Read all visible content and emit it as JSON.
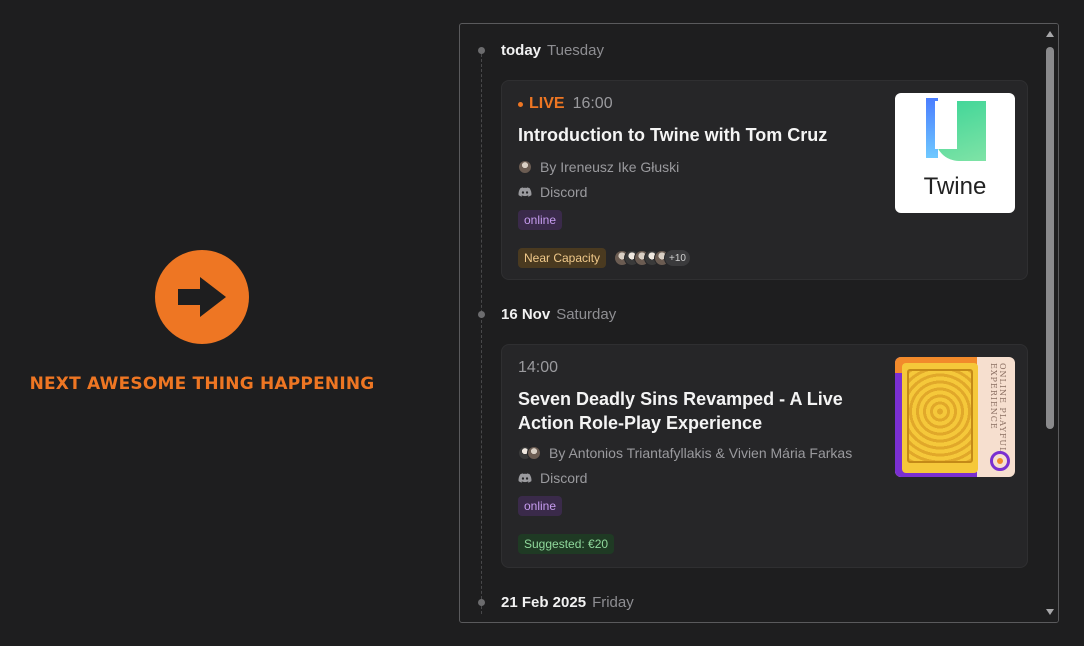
{
  "promo": {
    "title": "NEXT AWESOME THING HAPPENING",
    "icon": "arrow-right-icon",
    "accent": "#ee7623"
  },
  "timeline": {
    "dates": [
      {
        "main": "today",
        "day": "Tuesday"
      },
      {
        "main": "16 Nov",
        "day": "Saturday"
      },
      {
        "main": "21 Feb 2025",
        "day": "Friday"
      }
    ],
    "events": [
      {
        "live_label": "LIVE",
        "time": "16:00",
        "title": "Introduction to Twine with Tom Cruz",
        "by": "By Ireneusz Ike Głuski",
        "platform": "Discord",
        "tag": "online",
        "status": "Near Capacity",
        "attendees_more": "+10",
        "thumb_text": "Twine"
      },
      {
        "time": "14:00",
        "title": "Seven Deadly Sins Revamped - A Live Action Role-Play Experience",
        "by": "By Antonios Triantafyllakis & Vivien Mária Farkas",
        "platform": "Discord",
        "tag": "online",
        "price": "Suggested: €20",
        "thumb_text": "ONLINE PLAYFUL EXPERIENCE"
      }
    ]
  }
}
